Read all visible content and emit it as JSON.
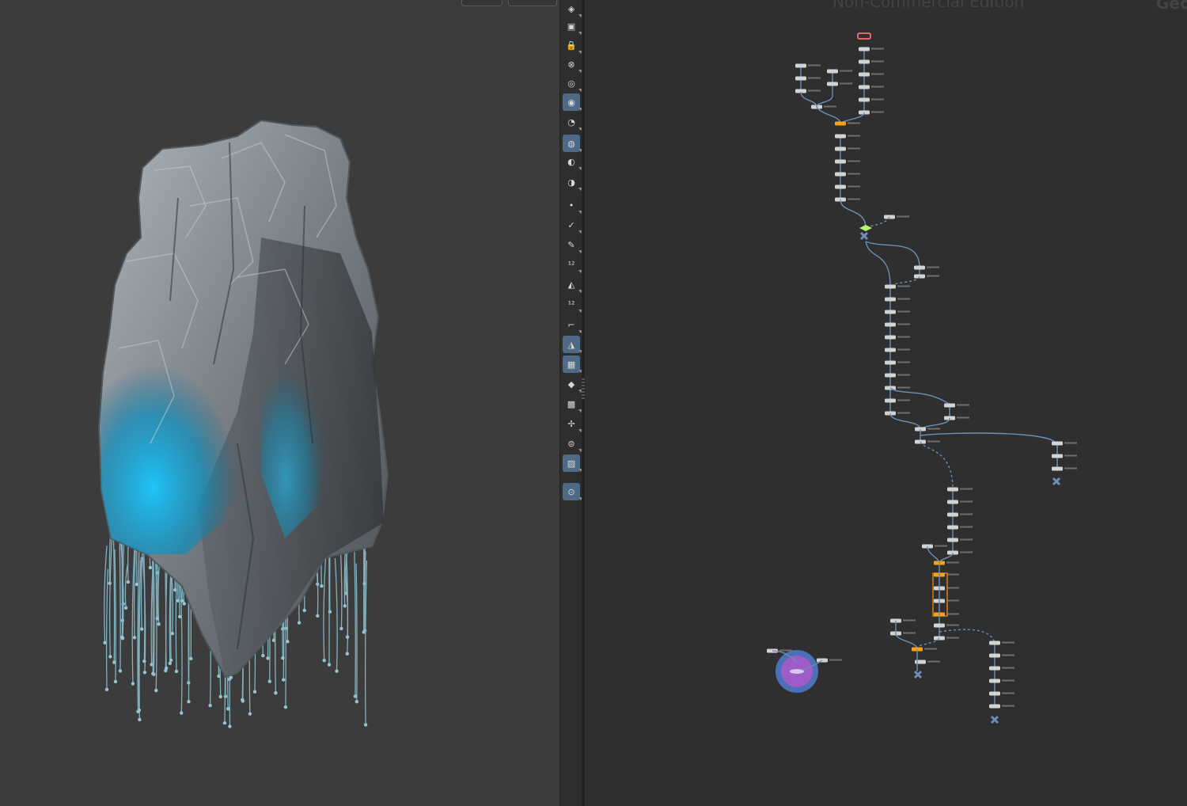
{
  "network": {
    "watermark": "Non-Commercial Edition",
    "context_label": "Geo"
  },
  "toolbar": {
    "items": [
      {
        "icon": "eye-layers-icon",
        "active": false
      },
      {
        "icon": "select-geometry-icon",
        "active": false
      },
      {
        "icon": "lock-icon",
        "active": false
      },
      {
        "icon": "ghost-icon",
        "active": false
      },
      {
        "icon": "ghost-other-objects-icon",
        "active": false
      },
      {
        "icon": "lighting-headlight-icon",
        "active": true
      },
      {
        "icon": "lighting-normal-icon",
        "active": false
      },
      {
        "icon": "shading-mode-icon",
        "active": true
      },
      {
        "icon": "visibility-icon",
        "active": false
      },
      {
        "icon": "camera-visibility-icon",
        "active": false
      },
      {
        "icon": "display-points-icon",
        "active": false
      },
      {
        "icon": "point-normals-icon",
        "active": false
      },
      {
        "icon": "point-velocity-icon",
        "active": false
      },
      {
        "icon": "point-numbers-icon",
        "active": false
      },
      {
        "icon": "primitive-normals-icon",
        "active": false
      },
      {
        "icon": "primitive-numbers-icon",
        "active": false
      },
      {
        "icon": "profile-curves-icon",
        "active": false
      },
      {
        "icon": "hull-display-icon",
        "active": true
      },
      {
        "icon": "texture-checker-icon",
        "active": true
      },
      {
        "icon": "backface-icon",
        "active": false
      },
      {
        "icon": "uv-display-icon",
        "active": false
      },
      {
        "icon": "pivot-display-icon",
        "active": false
      },
      {
        "icon": "viewport-layout-icon",
        "active": false
      },
      {
        "icon": "background-image-icon",
        "active": true
      },
      {
        "icon": "pin-viewport-icon",
        "active": true
      }
    ]
  },
  "colors": {
    "viewport_bg": "#3c3c3c",
    "network_bg": "#2f2f2f",
    "wire": "#6d8fb6",
    "node": "#d3d3d3",
    "node_selected": "#f4a21a",
    "node_output": "#e06a6a",
    "node_switch": "#b6f56b",
    "loop_frame": "#e07b12",
    "sticky_circle_outer": "#4f7bd0",
    "sticky_circle_inner": "#9d5cc6",
    "rock_blue": "#12a6d6",
    "rock_grey": "#8e959b"
  }
}
